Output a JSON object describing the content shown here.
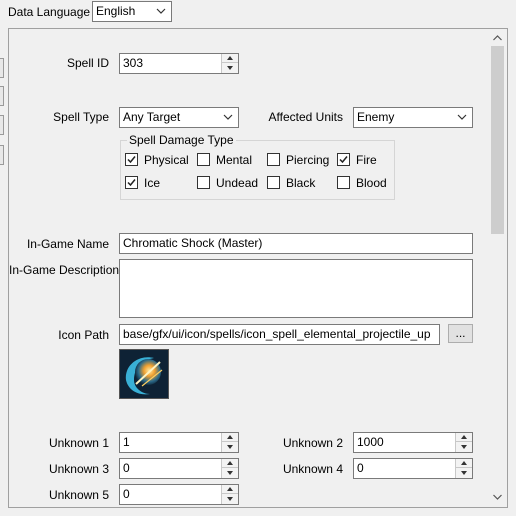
{
  "header": {
    "data_language_label": "Data Language",
    "data_language_value": "English"
  },
  "spell_id": {
    "label": "Spell ID",
    "value": "303"
  },
  "spell_type": {
    "label": "Spell Type",
    "value": "Any Target"
  },
  "affected_units": {
    "label": "Affected Units",
    "value": "Enemy"
  },
  "damage_type": {
    "title": "Spell Damage Type",
    "items": [
      {
        "label": "Physical",
        "checked": true
      },
      {
        "label": "Mental",
        "checked": false
      },
      {
        "label": "Piercing",
        "checked": false
      },
      {
        "label": "Fire",
        "checked": true
      },
      {
        "label": "Ice",
        "checked": true
      },
      {
        "label": "Undead",
        "checked": false
      },
      {
        "label": "Black",
        "checked": false
      },
      {
        "label": "Blood",
        "checked": false
      }
    ]
  },
  "ingame_name": {
    "label": "In-Game Name",
    "value": "Chromatic Shock (Master)"
  },
  "ingame_description": {
    "label": "In-Game Description",
    "value": ""
  },
  "icon_path": {
    "label": "Icon Path",
    "value": "base/gfx/ui/icon/spells/icon_spell_elemental_projectile_up",
    "browse_label": "..."
  },
  "unknowns": [
    {
      "label": "Unknown 1",
      "value": "1"
    },
    {
      "label": "Unknown 2",
      "value": "1000"
    },
    {
      "label": "Unknown 3",
      "value": "0"
    },
    {
      "label": "Unknown 4",
      "value": "0"
    },
    {
      "label": "Unknown 5",
      "value": "0"
    }
  ],
  "icons": {
    "chevron": "chevron-down-icon",
    "spin": "spinner-arrows-icon",
    "check": "check-icon"
  }
}
